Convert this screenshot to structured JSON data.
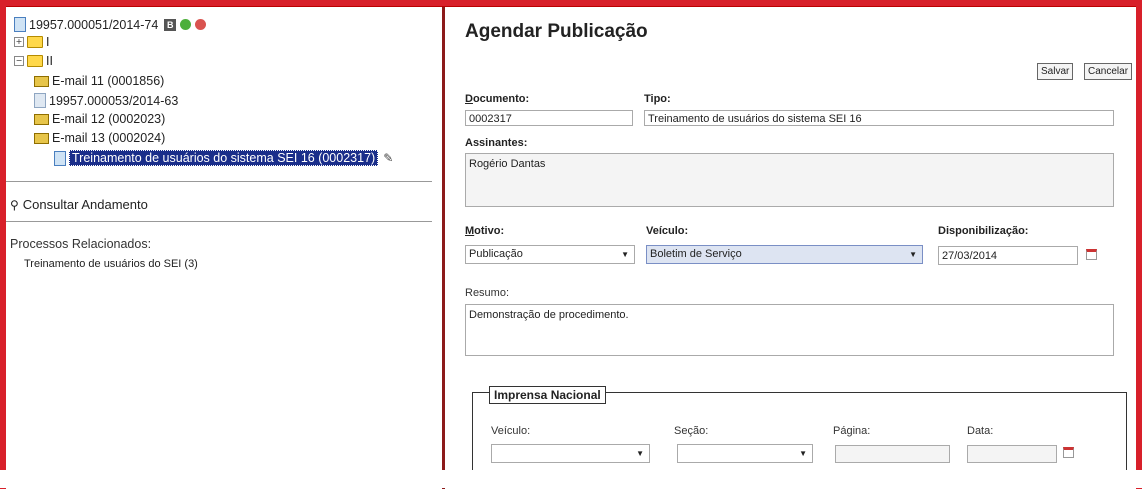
{
  "tree": {
    "process_number": "19957.000051/2014-74",
    "badge": "B",
    "folder_1": "I",
    "folder_2": "II",
    "docs": [
      "E-mail 11 (0001856)",
      "19957.000053/2014-63",
      "E-mail 12 (0002023)",
      "E-mail 13 (0002024)",
      "Treinamento de usuários do sistema SEI 16 (0002317)"
    ]
  },
  "left": {
    "consult_label": "Consultar Andamento",
    "related_title": "Processos Relacionados:",
    "related_item": "Treinamento de usuários do SEI (3)"
  },
  "form": {
    "title": "Agendar Publicação",
    "save_label": "Salvar",
    "cancel_label": "Cancelar",
    "documento_label": "Documento:",
    "documento_value": "0002317",
    "tipo_label": "Tipo:",
    "tipo_value": "Treinamento de usuários do sistema SEI 16",
    "assinantes_label": "Assinantes:",
    "assinantes_value": "Rogério Dantas",
    "motivo_label": "Motivo:",
    "motivo_value": "Publicação",
    "veiculo_label": "Veículo:",
    "veiculo_value": "Boletim de Serviço",
    "disponibilizacao_label": "Disponibilização:",
    "disponibilizacao_value": "27/03/2014",
    "resumo_label": "Resumo:",
    "resumo_value": "Demonstração de procedimento."
  },
  "imprensa": {
    "legend": "Imprensa Nacional",
    "veiculo_label": "Veículo:",
    "secao_label": "Seção:",
    "pagina_label": "Página:",
    "data_label": "Data:"
  },
  "colors": {
    "frame": "#d8202a",
    "selection": "#1a2e8a"
  }
}
